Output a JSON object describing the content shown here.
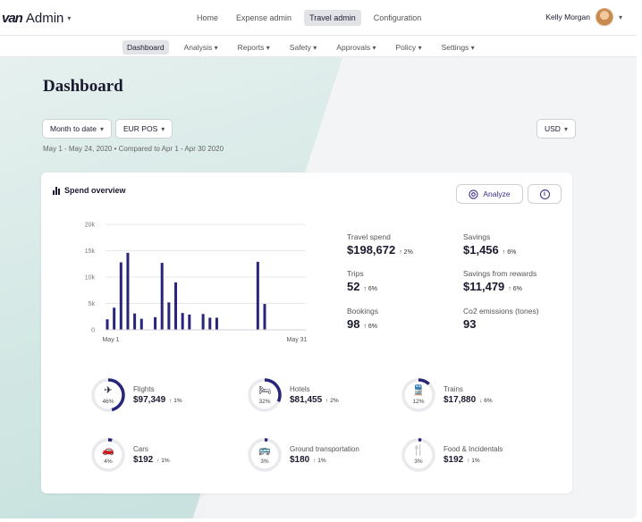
{
  "app": {
    "logo_text": "van",
    "name": "Admin"
  },
  "topnav": [
    {
      "label": "Home",
      "active": false
    },
    {
      "label": "Expense admin",
      "active": false
    },
    {
      "label": "Travel admin",
      "active": true
    },
    {
      "label": "Configuration",
      "active": false
    }
  ],
  "user": {
    "name": "Kelly Morgan"
  },
  "subnav": [
    {
      "label": "Dashboard",
      "active": true
    },
    {
      "label": "Analysis",
      "active": false
    },
    {
      "label": "Reports",
      "active": false
    },
    {
      "label": "Safety",
      "active": false
    },
    {
      "label": "Approvals",
      "active": false
    },
    {
      "label": "Policy",
      "active": false
    },
    {
      "label": "Settings",
      "active": false
    }
  ],
  "page": {
    "title": "Dashboard",
    "filter_period": "Month to date",
    "filter_pos": "EUR POS",
    "currency": "USD",
    "date_range": "May 1 - May 24, 2020  •  Compared to Apr 1 - Apr 30 2020"
  },
  "overview": {
    "title": "Spend overview",
    "analyze_label": "Analyze",
    "info_glyph": "i"
  },
  "chart_data": {
    "type": "bar",
    "yticks": [
      "20k",
      "15k",
      "10k",
      "5k",
      "0"
    ],
    "ylim": [
      0,
      20000
    ],
    "x_start_label": "May 1",
    "x_end_label": "May 31",
    "values": [
      2000,
      4200,
      12800,
      14600,
      3100,
      2100,
      0,
      2400,
      12700,
      5200,
      9000,
      3200,
      2900,
      0,
      3000,
      2300,
      2300,
      0,
      0,
      0,
      0,
      0,
      12900,
      4900
    ]
  },
  "stats": [
    {
      "label": "Travel spend",
      "value": "$198,672",
      "delta": "↑ 2%"
    },
    {
      "label": "Savings",
      "value": "$1,456",
      "delta": "↑ 6%"
    },
    {
      "label": "Trips",
      "value": "52",
      "delta": "↑ 6%"
    },
    {
      "label": "Savings from rewards",
      "value": "$11,479",
      "delta": "↑ 6%"
    },
    {
      "label": "Bookings",
      "value": "98",
      "delta": "↑ 6%"
    },
    {
      "label": "Co2 emissions (tones)",
      "value": "93",
      "delta": ""
    }
  ],
  "categories": [
    {
      "label": "Flights",
      "value": "$97,349",
      "delta": "↑ 1%",
      "pct_label": "46%",
      "pct": 46,
      "icon": "airplane-icon",
      "glyph": "✈"
    },
    {
      "label": "Hotels",
      "value": "$81,455",
      "delta": "↑ 2%",
      "pct_label": "32%",
      "pct": 32,
      "icon": "bed-icon",
      "glyph": "🛏"
    },
    {
      "label": "Trains",
      "value": "$17,880",
      "delta": "↓ 6%",
      "pct_label": "12%",
      "pct": 12,
      "icon": "train-icon",
      "glyph": "🚆"
    },
    {
      "label": "Cars",
      "value": "$192",
      "delta": "↑ 1%",
      "pct_label": "4%",
      "pct": 4,
      "icon": "car-icon",
      "glyph": "🚗"
    },
    {
      "label": "Ground transportation",
      "value": "$180",
      "delta": "↑ 1%",
      "pct_label": "3%",
      "pct": 3,
      "icon": "bus-icon",
      "glyph": "🚌"
    },
    {
      "label": "Food & Incidentals",
      "value": "$192",
      "delta": "↑ 1%",
      "pct_label": "3%",
      "pct": 3,
      "icon": "utensils-icon",
      "glyph": "🍴"
    }
  ],
  "colors": {
    "accent": "#27267a",
    "ring_track": "#e9e9ee",
    "purple": "#3b2b8c"
  }
}
